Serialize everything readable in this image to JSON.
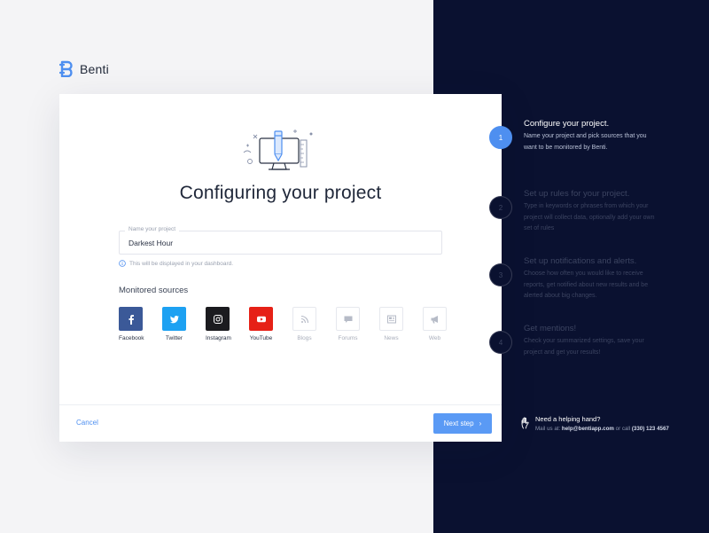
{
  "brand": {
    "name": "Benti",
    "accent": "#4e8ff0"
  },
  "card": {
    "title": "Configuring your project",
    "project_field": {
      "label": "Name your project",
      "value": "Darkest Hour"
    },
    "hint": "This will be displayed in your dashboard.",
    "sources_title": "Monitored sources",
    "sources": [
      {
        "label": "Facebook",
        "icon": "facebook-icon",
        "selected": true,
        "color": "#3b5998"
      },
      {
        "label": "Twitter",
        "icon": "twitter-icon",
        "selected": true,
        "color": "#1da1f2"
      },
      {
        "label": "Instagram",
        "icon": "instagram-icon",
        "selected": true,
        "color": "#1b1b1f"
      },
      {
        "label": "YouTube",
        "icon": "youtube-icon",
        "selected": true,
        "color": "#e62117"
      },
      {
        "label": "Blogs",
        "icon": "rss-icon",
        "selected": false
      },
      {
        "label": "Forums",
        "icon": "forum-icon",
        "selected": false
      },
      {
        "label": "News",
        "icon": "news-icon",
        "selected": false
      },
      {
        "label": "Web",
        "icon": "megaphone-icon",
        "selected": false
      }
    ],
    "cancel_label": "Cancel",
    "next_label": "Next step"
  },
  "steps": [
    {
      "num": "1",
      "title": "Configure your project.",
      "desc": "Name your project and pick sources that you want to be monitored by Benti.",
      "active": true
    },
    {
      "num": "2",
      "title": "Set up rules for your project.",
      "desc": "Type in keywords or phrases from which your project will collect data, optionally add your own set of rules",
      "active": false
    },
    {
      "num": "3",
      "title": "Set up notifications and alerts.",
      "desc": "Choose how often you would like to receive reports, get notified about new results and be alerted about big changes.",
      "active": false
    },
    {
      "num": "4",
      "title": "Get mentions!",
      "desc": "Check your summarized settings, save your project and get your results!",
      "active": false
    }
  ],
  "help": {
    "title": "Need a helping hand?",
    "prefix": "Mail us at: ",
    "email": "help@bentiapp.com",
    "middle": " or call ",
    "phone": "(330) 123 4567"
  }
}
